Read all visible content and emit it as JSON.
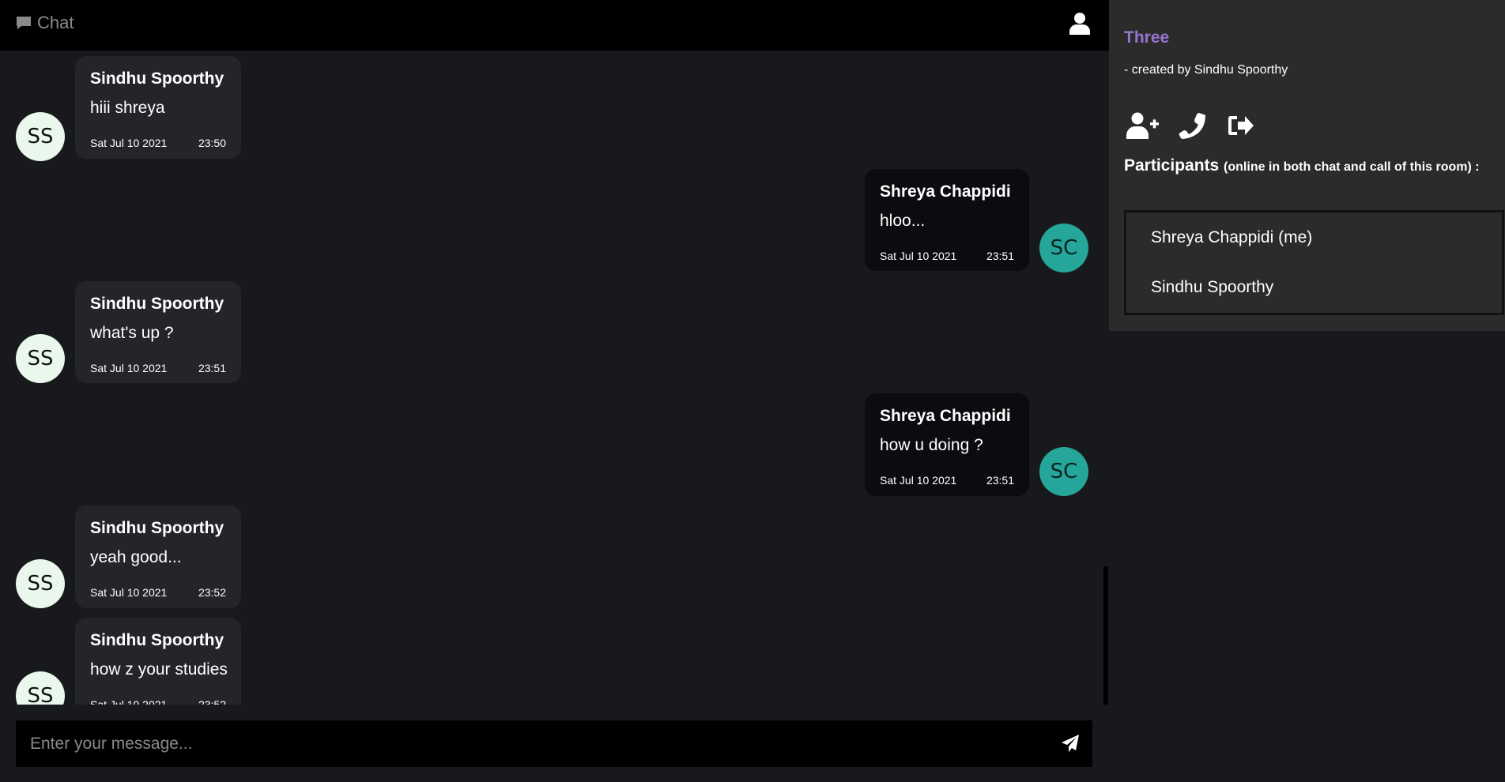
{
  "header": {
    "title": "Chat",
    "icons": {
      "chat": "chat-bubble-icon",
      "user": "user-icon"
    }
  },
  "messages": [
    {
      "side": "left",
      "sender": "Sindhu Spoorthy",
      "text": "hiii shreya",
      "date": "Sat Jul 10 2021",
      "time": "23:50",
      "initials": "SS"
    },
    {
      "side": "right",
      "sender": "Shreya Chappidi",
      "text": "hloo...",
      "date": "Sat Jul 10 2021",
      "time": "23:51",
      "initials": "SC"
    },
    {
      "side": "left",
      "sender": "Sindhu Spoorthy",
      "text": "what's up ?",
      "date": "Sat Jul 10 2021",
      "time": "23:51",
      "initials": "SS"
    },
    {
      "side": "right",
      "sender": "Shreya Chappidi",
      "text": "how u doing ?",
      "date": "Sat Jul 10 2021",
      "time": "23:51",
      "initials": "SC"
    },
    {
      "side": "left",
      "sender": "Sindhu Spoorthy",
      "text": "yeah good...",
      "date": "Sat Jul 10 2021",
      "time": "23:52",
      "initials": "SS"
    },
    {
      "side": "left",
      "sender": "Sindhu Spoorthy",
      "text": "how z your studies",
      "date": "Sat Jul 10 2021",
      "time": "23:52",
      "initials": "SS"
    }
  ],
  "composer": {
    "placeholder": "Enter your message...",
    "value": "",
    "send_icon": "paper-plane-icon"
  },
  "side_panel": {
    "room_name": "Three",
    "created_by": "- created by Sindhu Spoorthy",
    "actions": [
      "add-user-icon",
      "phone-icon",
      "leave-room-icon"
    ],
    "participants_label": "Participants",
    "participants_note": "(online in both chat and call of this room) :",
    "participants": [
      "Shreya Chappidi (me)",
      "Sindhu Spoorthy"
    ]
  },
  "colors": {
    "background": "#18191d",
    "header": "#000000",
    "bubble_left": "#24252b",
    "bubble_right": "#0b0c0f",
    "avatar_ss": "#e9f7ec",
    "avatar_sc": "#26a69a",
    "side_panel": "#2b2b2b",
    "room_name": "#9575cd"
  }
}
